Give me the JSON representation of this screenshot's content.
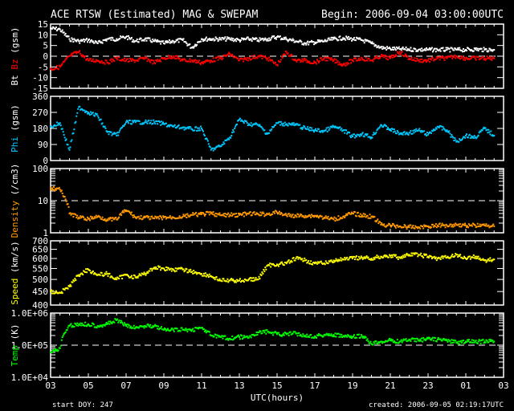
{
  "header": {
    "title": "ACE RTSW (Estimated) MAG & SWEPAM",
    "begin": "Begin: 2006-09-04 03:00:00UTC"
  },
  "footer": {
    "xlabel": "UTC(hours)",
    "start_doy": "start DOY: 247",
    "created": "created: 2006-09-05 02:19:17UTC"
  },
  "x_hours": [
    0,
    0.5,
    1,
    1.5,
    2,
    2.5,
    3,
    3.5,
    4,
    4.5,
    5,
    5.5,
    6,
    6.5,
    7,
    7.5,
    8,
    8.5,
    9,
    9.5,
    10,
    10.5,
    11,
    11.5,
    12,
    12.5,
    13,
    13.5,
    14,
    14.5,
    15,
    15.5,
    16,
    16.5,
    17,
    17.5,
    18,
    18.5,
    19,
    19.5,
    20,
    20.5,
    21,
    21.5,
    22,
    22.5,
    23,
    23.5
  ],
  "x_ticks": [
    "03",
    "05",
    "07",
    "09",
    "11",
    "13",
    "15",
    "17",
    "19",
    "21",
    "23",
    "01",
    "03"
  ],
  "chart_data": [
    {
      "type": "scatter",
      "ylabel_parts": [
        {
          "text": "Bt",
          "color": "#ffffff"
        },
        {
          "text": " Bz",
          "color": "#ff0000"
        },
        {
          "text": " (gsm)",
          "color": "#ffffff"
        }
      ],
      "scale": "linear",
      "ylim": [
        -15,
        15
      ],
      "yticks": [
        15,
        10,
        5,
        0,
        -5,
        -10,
        -15
      ],
      "ytick_labels": [
        "15",
        "10",
        "5",
        "0",
        "-5",
        "-10",
        "-15"
      ],
      "reference_line": 0,
      "series": [
        {
          "name": "Bt",
          "color": "#ffffff",
          "values": [
            13,
            12.5,
            8,
            7,
            7.5,
            6,
            8,
            8,
            9,
            7,
            8,
            7,
            6,
            7,
            7.5,
            4,
            8,
            8,
            8,
            8,
            7.5,
            8,
            7.5,
            8,
            9,
            8,
            7,
            6,
            6.5,
            7,
            8,
            8.5,
            8,
            7.5,
            6,
            4,
            3.5,
            3.3,
            3.2,
            3,
            3,
            3,
            3,
            3,
            3,
            3.2,
            3,
            3
          ]
        },
        {
          "name": "Bz",
          "color": "#ff0000",
          "values": [
            -6,
            -5,
            0,
            2,
            -2,
            -2,
            -3,
            -1,
            -2,
            -2,
            -1,
            -3,
            -1,
            0,
            -2,
            -2,
            -3,
            -2,
            -1,
            1,
            -2,
            -1,
            0,
            -1,
            -4,
            2,
            -2,
            -2,
            -3,
            -1,
            -2,
            -4,
            -2,
            -1,
            -2,
            0,
            -1,
            2,
            -1,
            -2,
            -2,
            -1,
            -1,
            0,
            -1,
            -1,
            -1,
            -1
          ]
        }
      ]
    },
    {
      "type": "scatter",
      "ylabel_parts": [
        {
          "text": "Phi",
          "color": "#00c8ff"
        },
        {
          "text": " (gsm)",
          "color": "#ffffff"
        }
      ],
      "scale": "linear",
      "ylim": [
        0,
        360
      ],
      "yticks": [
        360,
        270,
        180,
        90,
        0
      ],
      "ytick_labels": [
        "360",
        "270",
        "180",
        "90",
        "0"
      ],
      "series": [
        {
          "name": "Phi",
          "color": "#00c8ff",
          "values": [
            190,
            210,
            60,
            300,
            270,
            250,
            160,
            140,
            215,
            215,
            215,
            215,
            205,
            190,
            185,
            175,
            180,
            60,
            80,
            130,
            230,
            205,
            200,
            150,
            210,
            205,
            200,
            180,
            170,
            165,
            190,
            170,
            135,
            150,
            130,
            200,
            175,
            150,
            155,
            170,
            145,
            190,
            170,
            105,
            140,
            130,
            180,
            140
          ]
        }
      ]
    },
    {
      "type": "scatter",
      "ylabel_parts": [
        {
          "text": "Density",
          "color": "#ff9900"
        },
        {
          "text": " (/cm3)",
          "color": "#ffffff"
        }
      ],
      "scale": "log",
      "ylim": [
        1,
        100
      ],
      "yticks": [
        100,
        10,
        1
      ],
      "ytick_labels": [
        "100",
        "10",
        "1"
      ],
      "reference_line": 10,
      "series": [
        {
          "name": "Density",
          "color": "#ff9900",
          "values": [
            25,
            22,
            4,
            3,
            2.7,
            3.2,
            2.6,
            2.6,
            5,
            3,
            3,
            2.8,
            3,
            3,
            3.2,
            3.6,
            3.8,
            4,
            3.5,
            3.6,
            3.6,
            3.9,
            3.8,
            3.8,
            4.3,
            3.5,
            3.4,
            3.4,
            3.4,
            3,
            2.6,
            3.2,
            4,
            3.5,
            3.2,
            1.8,
            1.7,
            1.6,
            1.5,
            1.5,
            1.6,
            1.7,
            1.7,
            1.8,
            1.7,
            1.7,
            1.7,
            1.6
          ]
        }
      ]
    },
    {
      "type": "scatter",
      "ylabel_parts": [
        {
          "text": "Speed",
          "color": "#ffff00"
        },
        {
          "text": " (km/s)",
          "color": "#ffffff"
        }
      ],
      "scale": "log",
      "ylim": [
        400,
        700
      ],
      "yticks": [
        700,
        650,
        600,
        550,
        500,
        450,
        400
      ],
      "ytick_labels": [
        "700",
        "650",
        "600",
        "550",
        "500",
        "450",
        "400"
      ],
      "series": [
        {
          "name": "Speed",
          "color": "#ffff00",
          "values": [
            450,
            445,
            470,
            520,
            545,
            520,
            525,
            500,
            520,
            510,
            525,
            555,
            550,
            545,
            545,
            535,
            525,
            515,
            495,
            495,
            495,
            500,
            500,
            565,
            570,
            575,
            600,
            590,
            575,
            575,
            590,
            595,
            600,
            605,
            600,
            610,
            615,
            605,
            620,
            620,
            610,
            600,
            605,
            620,
            600,
            610,
            590,
            595
          ]
        }
      ]
    },
    {
      "type": "scatter",
      "ylabel_parts": [
        {
          "text": "Temp",
          "color": "#00ff00"
        },
        {
          "text": " (K)",
          "color": "#ffffff"
        }
      ],
      "scale": "log",
      "ylim": [
        10000,
        1000000
      ],
      "yticks": [
        1000000,
        100000,
        10000
      ],
      "ytick_labels": [
        "1.0E+06",
        "1.0E+05",
        "1.0E+04"
      ],
      "reference_line": 100000,
      "series": [
        {
          "name": "Temp",
          "color": "#00ff00",
          "values": [
            60000,
            80000,
            400000,
            450000,
            450000,
            400000,
            450000,
            600000,
            400000,
            350000,
            400000,
            400000,
            300000,
            300000,
            300000,
            300000,
            350000,
            200000,
            180000,
            160000,
            180000,
            170000,
            250000,
            260000,
            220000,
            220000,
            230000,
            200000,
            190000,
            210000,
            210000,
            190000,
            180000,
            190000,
            110000,
            130000,
            140000,
            130000,
            150000,
            140000,
            160000,
            150000,
            140000,
            120000,
            130000,
            130000,
            130000,
            130000
          ]
        }
      ]
    }
  ]
}
